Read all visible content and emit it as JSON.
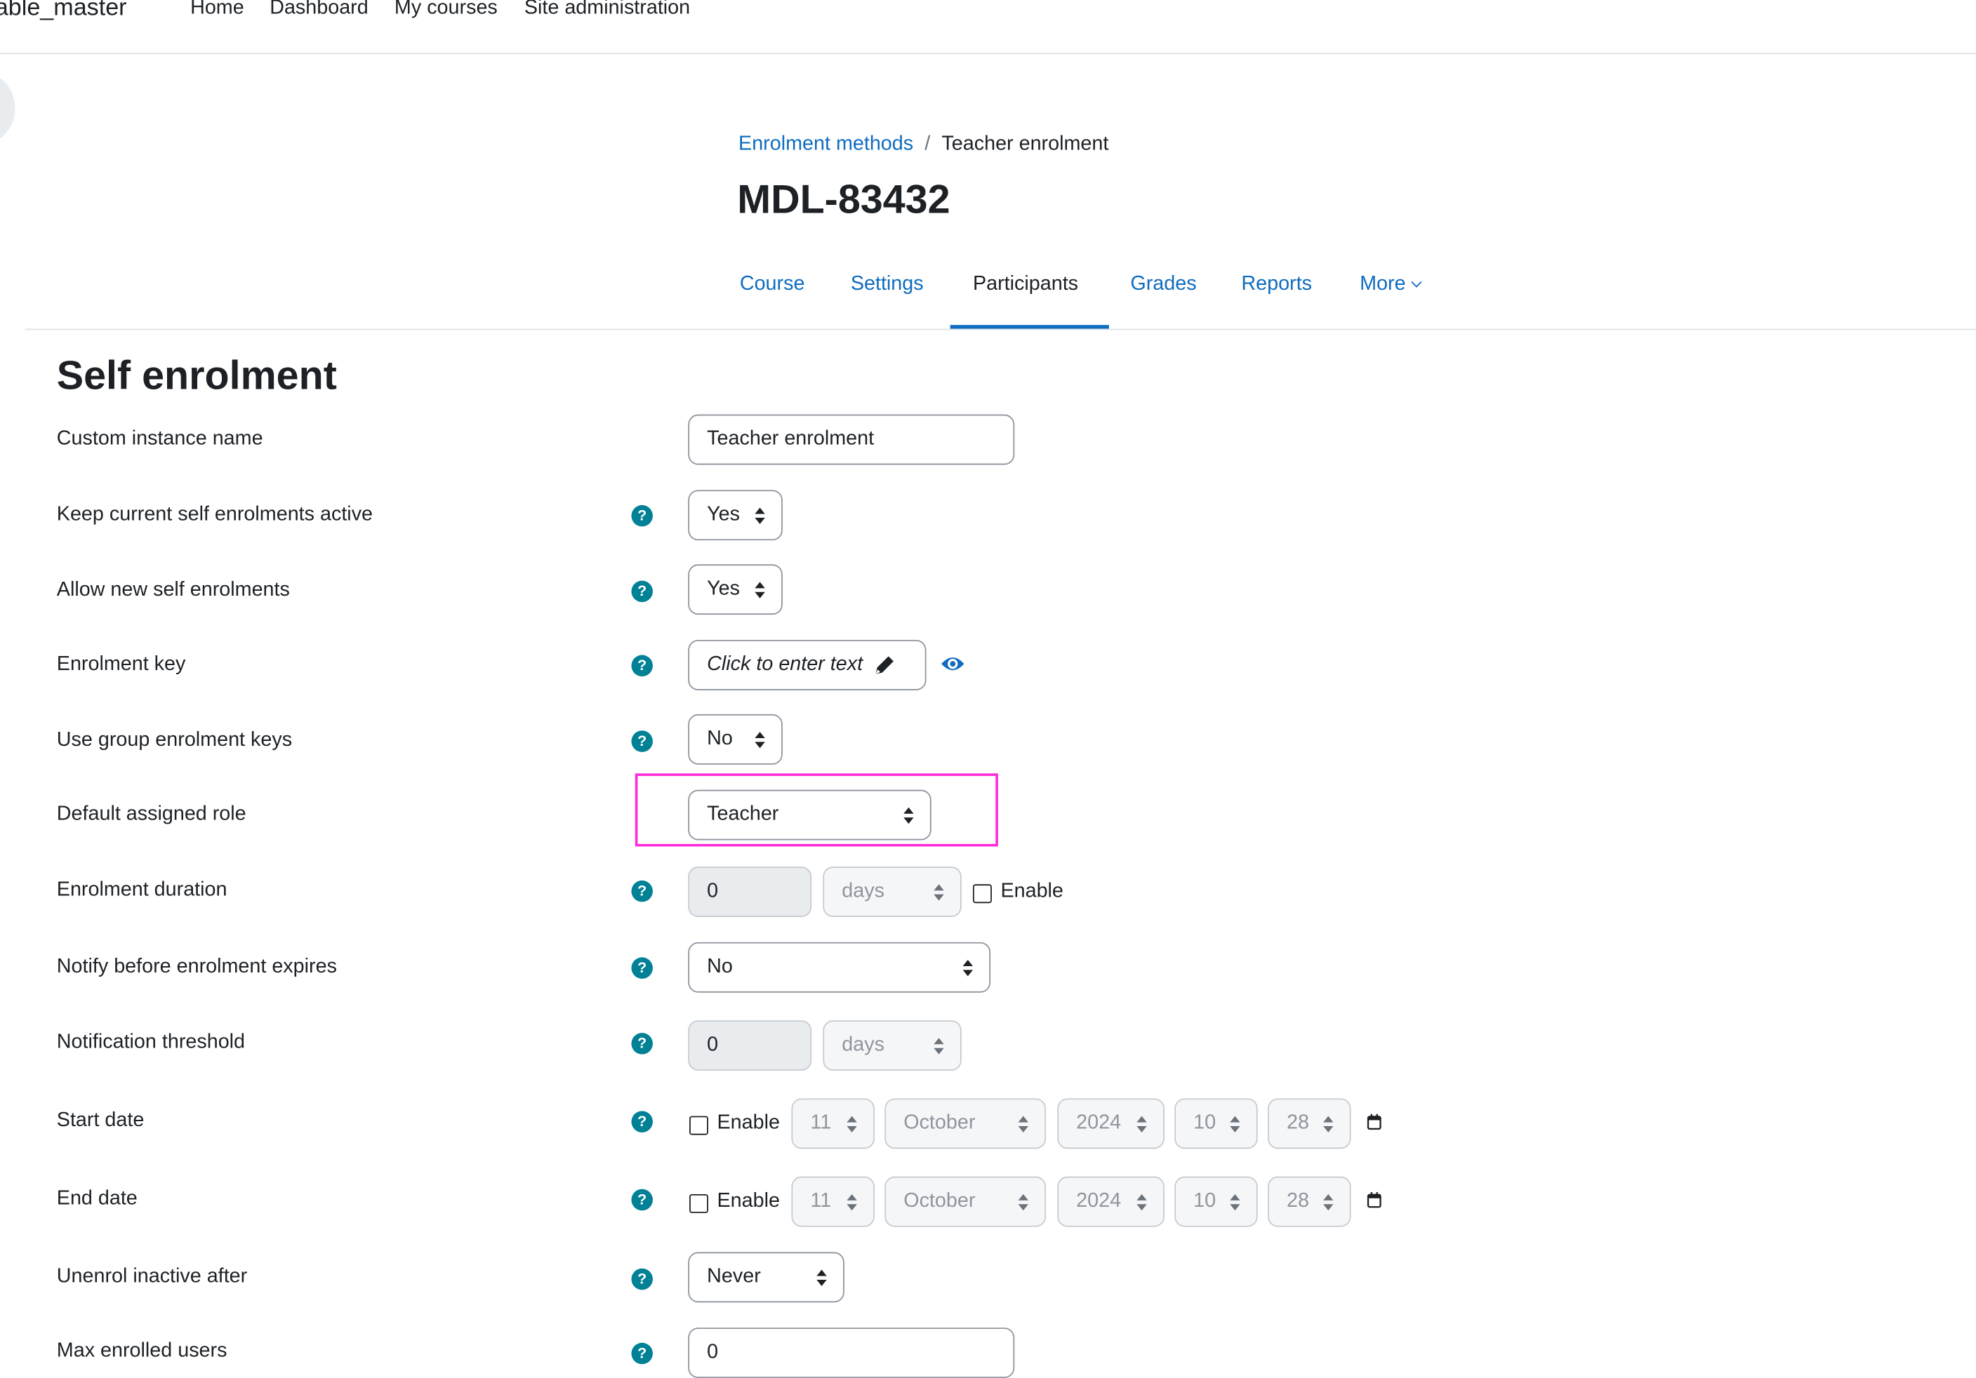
{
  "navbar": {
    "site_name": "able_master",
    "links": [
      "Home",
      "Dashboard",
      "My courses",
      "Site administration"
    ]
  },
  "breadcrumb": {
    "parent": "Enrolment methods",
    "separator": "/",
    "current": "Teacher enrolment"
  },
  "course_title": "MDL-83432",
  "tabs": [
    {
      "label": "Course",
      "active": false
    },
    {
      "label": "Settings",
      "active": false
    },
    {
      "label": "Participants",
      "active": true
    },
    {
      "label": "Grades",
      "active": false
    },
    {
      "label": "Reports",
      "active": false
    },
    {
      "label": "More",
      "active": false
    }
  ],
  "page_heading": "Self enrolment",
  "form": {
    "custom_instance_name": {
      "label": "Custom instance name",
      "value": "Teacher enrolment"
    },
    "keep_active": {
      "label": "Keep current self enrolments active",
      "value": "Yes"
    },
    "allow_new": {
      "label": "Allow new self enrolments",
      "value": "Yes"
    },
    "enrolment_key": {
      "label": "Enrolment key",
      "placeholder": "Click to enter text"
    },
    "group_keys": {
      "label": "Use group enrolment keys",
      "value": "No"
    },
    "default_role": {
      "label": "Default assigned role",
      "value": "Teacher"
    },
    "enrolment_duration": {
      "label": "Enrolment duration",
      "value": "0",
      "unit": "days",
      "enable_label": "Enable"
    },
    "notify_before": {
      "label": "Notify before enrolment expires",
      "value": "No"
    },
    "notification_threshold": {
      "label": "Notification threshold",
      "value": "0",
      "unit": "days"
    },
    "start_date": {
      "label": "Start date",
      "enable_label": "Enable",
      "day": "11",
      "month": "October",
      "year": "2024",
      "hour": "10",
      "minute": "28"
    },
    "end_date": {
      "label": "End date",
      "enable_label": "Enable",
      "day": "11",
      "month": "October",
      "year": "2024",
      "hour": "10",
      "minute": "28"
    },
    "unenrol_inactive": {
      "label": "Unenrol inactive after",
      "value": "Never"
    },
    "max_enrolled": {
      "label": "Max enrolled users",
      "value": "0"
    }
  },
  "help_icon_glyph": "?",
  "colors": {
    "link": "#0f6cbf",
    "help": "#008196",
    "highlight": "#ff2ad9"
  }
}
